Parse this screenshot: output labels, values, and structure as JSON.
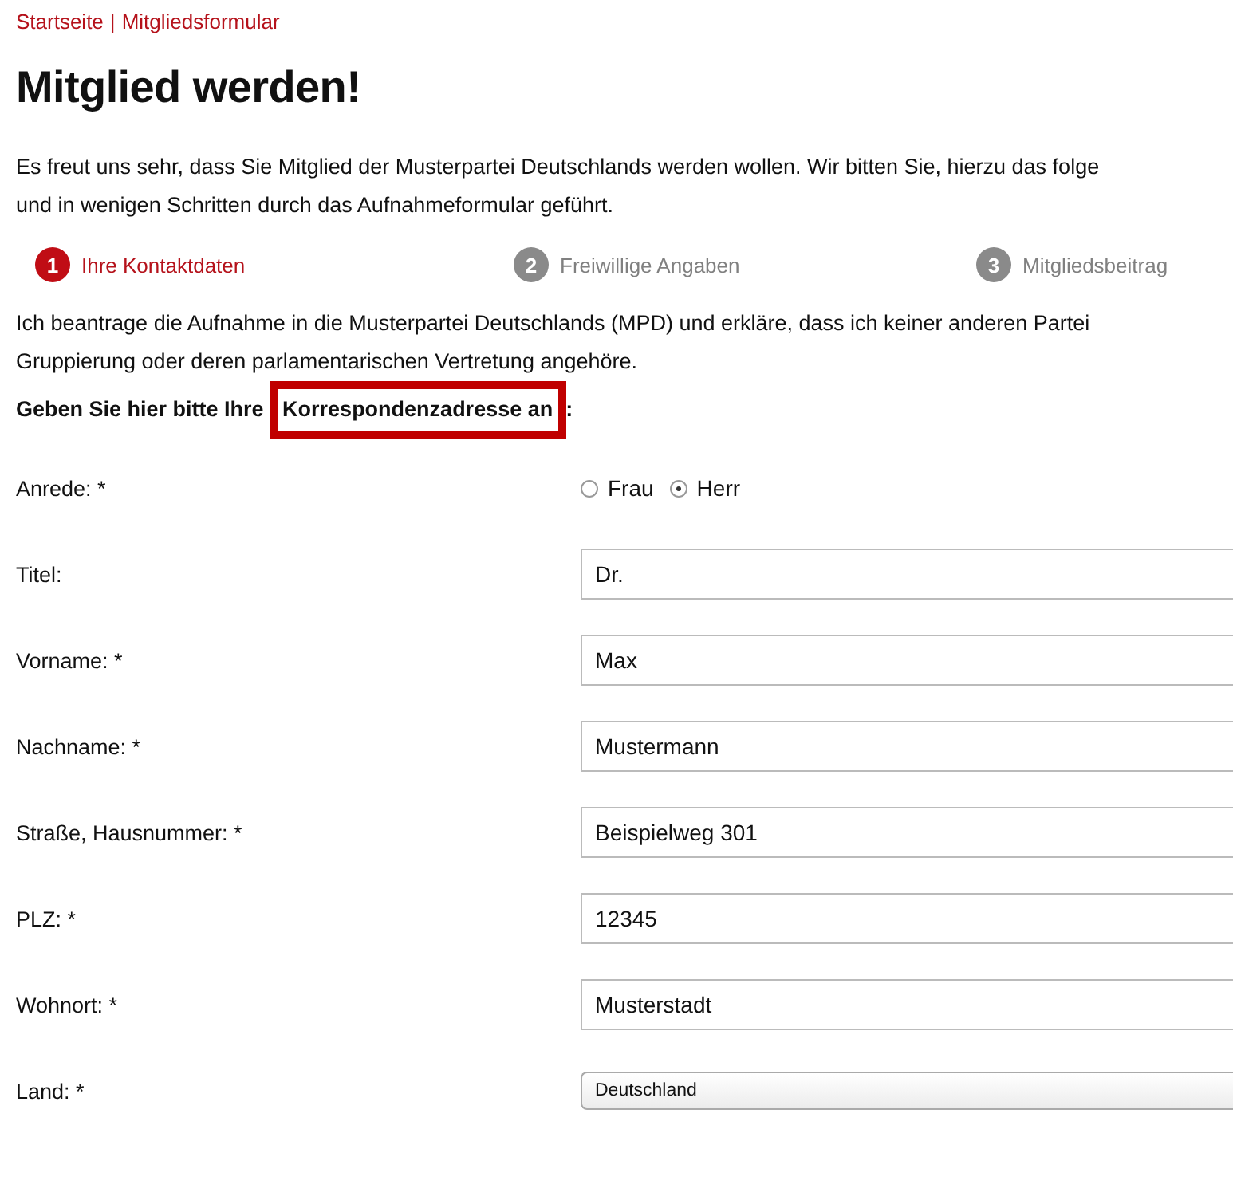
{
  "breadcrumb": [
    {
      "label": "Startseite"
    },
    {
      "label": "Mitgliedsformular"
    }
  ],
  "breadcrumb_separator": "|",
  "title": "Mitglied werden!",
  "intro_lines": [
    "Es freut uns sehr, dass Sie Mitglied der Musterpartei Deutschlands werden wollen. Wir bitten Sie, hierzu das folge",
    "und in wenigen Schritten durch das Aufnahmeformular geführt."
  ],
  "steps": [
    {
      "number": "1",
      "label": "Ihre Kontaktdaten",
      "selected": true
    },
    {
      "number": "2",
      "label": "Freiwillige Angaben",
      "selected": false
    },
    {
      "number": "3",
      "label": "Mitgliedsbeitrag",
      "selected": false
    }
  ],
  "declaration_lines": [
    "Ich beantrage die Aufnahme in die Musterpartei Deutschlands (MPD) und erkläre, dass ich keiner anderen Partei",
    "Gruppierung oder deren parlamentarischen Vertretung angehöre."
  ],
  "address_prompt": {
    "before": "Geben Sie hier bitte Ihre ",
    "highlight": "Korrespondenzadresse an",
    "after": ":",
    "highlighted": true
  },
  "fields": [
    {
      "kind": "radio",
      "label": "Anrede: *",
      "options": [
        {
          "label": "Frau",
          "selected": false
        },
        {
          "label": "Herr",
          "selected": true
        }
      ]
    },
    {
      "kind": "text",
      "label": "Titel:",
      "value": "Dr."
    },
    {
      "kind": "text",
      "label": "Vorname: *",
      "value": "Max"
    },
    {
      "kind": "text",
      "label": "Nachname: *",
      "value": "Mustermann"
    },
    {
      "kind": "text",
      "label": "Straße, Hausnummer: *",
      "value": "Beispielweg 301"
    },
    {
      "kind": "text",
      "label": "PLZ: *",
      "value": "12345"
    },
    {
      "kind": "text",
      "label": "Wohnort: *",
      "value": "Musterstadt"
    },
    {
      "kind": "select",
      "label": "Land: *",
      "value": "Deutschland"
    }
  ]
}
